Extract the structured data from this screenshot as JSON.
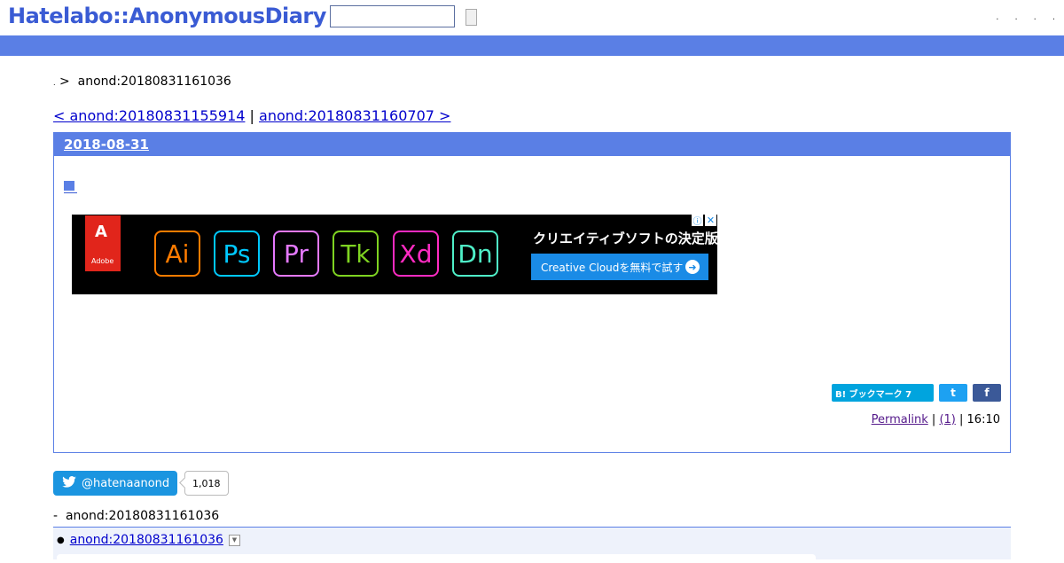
{
  "header": {
    "logo": "Hatelabo::AnonymousDiary",
    "search_value": "",
    "links": [
      ".",
      ".",
      ".",
      "."
    ]
  },
  "breadcrumb": {
    "home": ".",
    "separator": ">",
    "current": "anond:20180831161036"
  },
  "pager": {
    "prev": "< anond:20180831155914",
    "separator": "|",
    "next": "anond:20180831160707 >"
  },
  "day": {
    "date": "2018-08-31",
    "section_mark": "■"
  },
  "ad": {
    "brand_glyph": "A",
    "brand_name": "Adobe",
    "apps": [
      {
        "label": "Ai",
        "color": "#ff7c00"
      },
      {
        "label": "Ps",
        "color": "#00c8ff"
      },
      {
        "label": "Pr",
        "color": "#e579ff"
      },
      {
        "label": "Tk",
        "color": "#7ed321"
      },
      {
        "label": "Xd",
        "color": "#ff2bc2"
      },
      {
        "label": "Dn",
        "color": "#4ff0c8"
      }
    ],
    "tagline": "クリエイティブソフトの決定版",
    "cta": "Creative Cloudを無料で試す",
    "info_icon": "ⓘ",
    "close_icon": "✕"
  },
  "share": {
    "bookmark": "B! ブックマーク 7",
    "twitter": "t",
    "facebook": "f"
  },
  "entry_footer": {
    "permalink": "Permalink",
    "sep1": "|",
    "comments": "(1)",
    "sep2": "|",
    "time": "16:10"
  },
  "follow": {
    "handle": "@hatenaanond",
    "count": "1,018"
  },
  "tree": {
    "root_prefix": "-",
    "root": "anond:20180831161036",
    "item": "anond:20180831161036"
  },
  "colors": {
    "brand_blue": "#5a7fe5",
    "logo_blue": "#3a5bd4"
  }
}
